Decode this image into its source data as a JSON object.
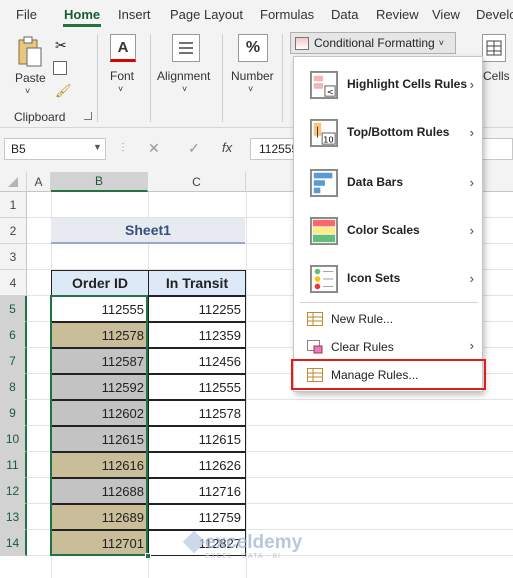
{
  "menu_tabs": [
    "File",
    "Home",
    "Insert",
    "Page Layout",
    "Formulas",
    "Data",
    "Review",
    "View",
    "Develo"
  ],
  "ribbon": {
    "paste": "Paste",
    "clipboard": "Clipboard",
    "font": "Font",
    "alignment": "Alignment",
    "number": "Number",
    "percent_glyph": "%",
    "cells": "Cells",
    "conditional_formatting": "Conditional Formatting"
  },
  "formula_bar": {
    "name_box": "B5",
    "fx": "fx",
    "value": "112555"
  },
  "columns": [
    "A",
    "B",
    "C"
  ],
  "rows": [
    "1",
    "2",
    "3",
    "4",
    "5",
    "6",
    "7",
    "8",
    "9",
    "10",
    "11",
    "12",
    "13",
    "14"
  ],
  "sheet_title": "Sheet1",
  "table": {
    "headers": [
      "Order ID",
      "In Transit"
    ],
    "rows": [
      {
        "order": "112555",
        "transit": "112255"
      },
      {
        "order": "112578",
        "transit": "112359"
      },
      {
        "order": "112587",
        "transit": "112456"
      },
      {
        "order": "112592",
        "transit": "112555"
      },
      {
        "order": "112602",
        "transit": "112578"
      },
      {
        "order": "112615",
        "transit": "112615"
      },
      {
        "order": "112616",
        "transit": "112626"
      },
      {
        "order": "112688",
        "transit": "112716"
      },
      {
        "order": "112689",
        "transit": "112759"
      },
      {
        "order": "112701",
        "transit": "112827"
      }
    ]
  },
  "dropdown": {
    "items": [
      {
        "label": "Highlight Cells Rules",
        "icon": "highlight-cells-icon"
      },
      {
        "label": "Top/Bottom Rules",
        "icon": "top-bottom-icon"
      },
      {
        "label": "Data Bars",
        "icon": "data-bars-icon"
      },
      {
        "label": "Color Scales",
        "icon": "color-scales-icon"
      },
      {
        "label": "Icon Sets",
        "icon": "icon-sets-icon"
      }
    ],
    "small_items": [
      {
        "label": "New Rule...",
        "icon": "new-rule-icon"
      },
      {
        "label": "Clear Rules",
        "icon": "clear-rules-icon"
      },
      {
        "label": "Manage Rules...",
        "icon": "manage-rules-icon"
      }
    ]
  },
  "watermark": {
    "brand": "exceldemy",
    "tagline": "EXCEL · DATA · BI"
  },
  "colors": {
    "accent": "#217346",
    "highlight_fill": "#c9bd9a",
    "gray_fill": "#c3c3c3",
    "red_box": "#e21b1b"
  }
}
